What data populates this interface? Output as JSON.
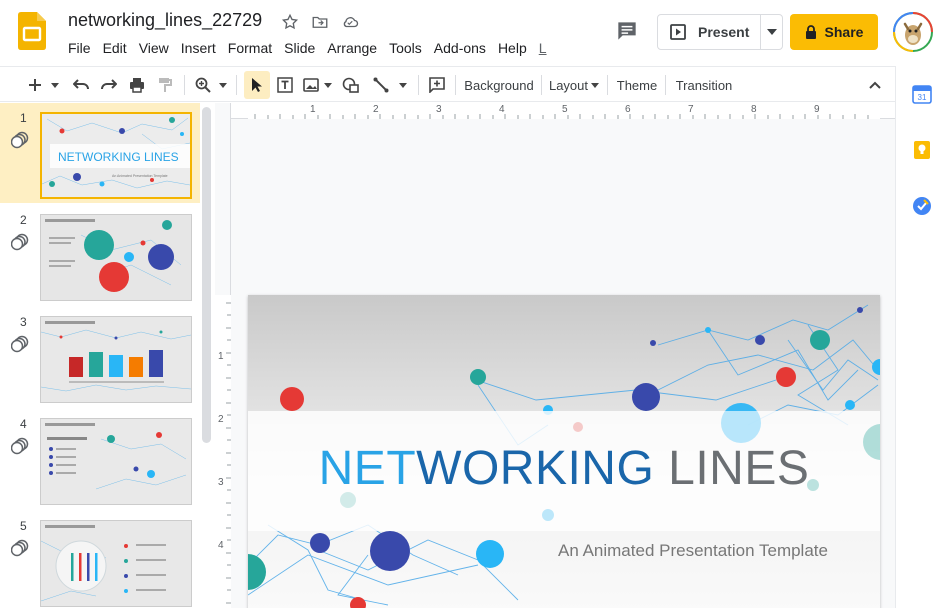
{
  "doc": {
    "title": "networking_lines_22729",
    "menus": [
      "File",
      "Edit",
      "View",
      "Insert",
      "Format",
      "Slide",
      "Arrange",
      "Tools",
      "Add-ons",
      "Help",
      "L"
    ]
  },
  "header": {
    "present_label": "Present",
    "share_label": "Share"
  },
  "toolbar": {
    "background_label": "Background",
    "layout_label": "Layout",
    "theme_label": "Theme",
    "transition_label": "Transition"
  },
  "ruler": {
    "h_labels": [
      "1",
      "2",
      "3",
      "4",
      "5",
      "6",
      "7",
      "8",
      "9"
    ],
    "v_labels": [
      "1",
      "2",
      "3",
      "4"
    ]
  },
  "filmstrip": {
    "slides": [
      {
        "number": "1",
        "thumb_title": "NETWORKING LINES",
        "thumb_subtitle": "An Animated Presentation Template"
      },
      {
        "number": "2"
      },
      {
        "number": "3"
      },
      {
        "number": "4"
      },
      {
        "number": "5"
      }
    ]
  },
  "slide": {
    "title_part1": "NET",
    "title_part2": "WORKING",
    "title_part3": " LINES",
    "subtitle": "An Animated Presentation Template"
  },
  "colors": {
    "accent_yellow": "#fbbc04",
    "selection_bg": "#feefc3",
    "title_light_blue": "#29a3e6",
    "title_dark_blue": "#1a66aa",
    "title_gray": "#6b6f73",
    "node_red": "#e53935",
    "node_teal": "#26a69a",
    "node_navy": "#3949ab",
    "node_blue": "#29b6f6"
  }
}
